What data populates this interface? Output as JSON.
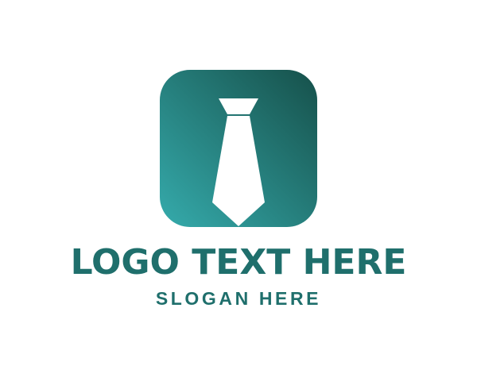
{
  "logo": {
    "title": "LOGO TEXT HERE",
    "slogan": "SLOGAN HERE",
    "icon": "necktie-icon"
  },
  "colors": {
    "text": "#1f6f6c",
    "tile_gradient_start": "#35abac",
    "tile_gradient_end": "#16504a",
    "tie": "#ffffff",
    "background": "#ffffff"
  }
}
